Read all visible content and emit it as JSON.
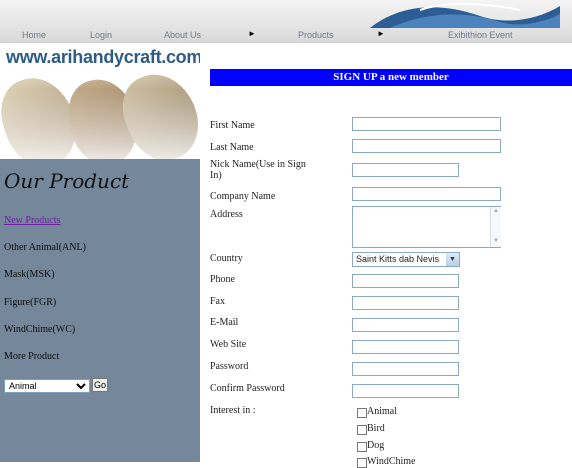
{
  "nav": {
    "items": [
      "Home",
      "Login",
      "About Us",
      "Products",
      "Exibithion Event"
    ],
    "separator": "►"
  },
  "logo": {
    "text": "www.arihandycraft.com"
  },
  "sidebar": {
    "title": "Our Product",
    "items": [
      {
        "label": "New Products",
        "link": true
      },
      {
        "label": "Other Animal(ANL)",
        "link": false
      },
      {
        "label": "Mask(MSK)",
        "link": false
      },
      {
        "label": "Figure(FGR)",
        "link": false
      },
      {
        "label": "WindChime(WC)",
        "link": false
      },
      {
        "label": "More Product",
        "link": false
      }
    ],
    "category_select": "Animal",
    "go_label": "Go"
  },
  "form": {
    "header": "SIGN UP a new member",
    "labels": {
      "first_name": "First Name",
      "last_name": "Last Name",
      "nick_name": "Nick Name(Use in Sign In)",
      "company_name": "Company Name",
      "address": "Address",
      "country": "Country",
      "phone": "Phone",
      "fax": "Fax",
      "email": "E-Mail",
      "website": "Web Site",
      "password": "Password",
      "confirm_password": "Confirm Password",
      "interest": "Interest in :"
    },
    "country_value": "Saint Kitts dab Nevis",
    "interests": [
      "Animal",
      "Bird",
      "Dog",
      "WindChime"
    ]
  },
  "colors": {
    "header_bg": "#0000ff",
    "sidebar_bg": "#75879b",
    "logo_text": "#2d5c86",
    "link": "#6d1fa0"
  }
}
